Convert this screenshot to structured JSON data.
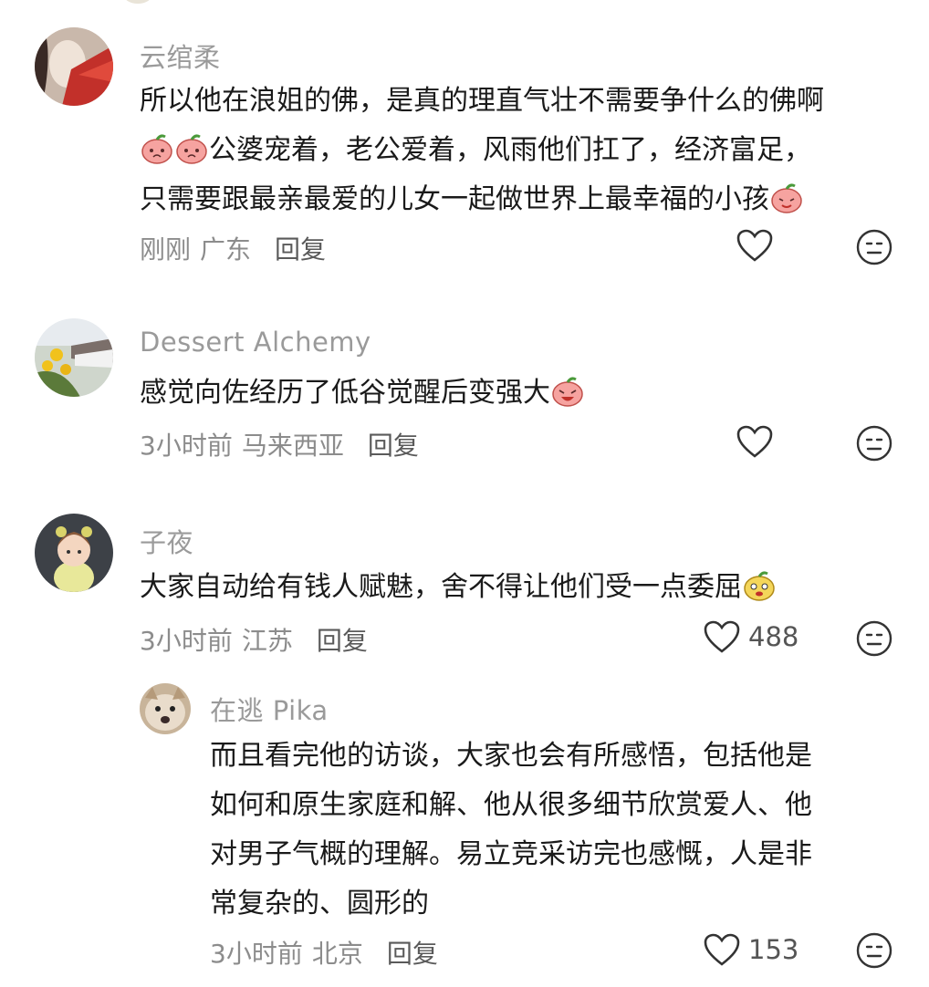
{
  "comments": [
    {
      "username": "云绾柔",
      "lines": [
        "所以他在浪姐的佛，是真的理直气壮不需要争什么的佛啊",
        "公婆宠着，老公爱着，风雨他们扛了，经济富足，",
        "只需要跟最亲最爱的儿女一起做世界上最幸福的小孩"
      ],
      "time": "刚刚",
      "location": "广东",
      "reply_label": "回复",
      "likes": ""
    },
    {
      "username": "Dessert Alchemy",
      "lines": [
        "感觉向佐经历了低谷觉醒后变强大"
      ],
      "time": "3小时前",
      "location": "马来西亚",
      "reply_label": "回复",
      "likes": ""
    },
    {
      "username": "子夜",
      "lines": [
        "大家自动给有钱人赋魅，舍不得让他们受一点委屈"
      ],
      "time": "3小时前",
      "location": "江苏",
      "reply_label": "回复",
      "likes": "488"
    },
    {
      "username": "在逃 Pika",
      "lines": [
        "而且看完他的访谈，大家也会有所感悟，包括他是",
        "如何和原生家庭和解、他从很多细节欣赏爱人、他",
        "对男子气概的理解。易立竞采访完也感慨，人是非",
        "常复杂的、圆形的"
      ],
      "time": "3小时前",
      "location": "北京",
      "reply_label": "回复",
      "likes": "153"
    }
  ],
  "icons": {
    "like": "heart-outline-icon",
    "dislike": "neutral-face-icon",
    "emoji": "peach-emoji-icon"
  },
  "colors": {
    "username": "#9a9a9a",
    "text": "#1a1a1a",
    "meta": "#8c8c8c",
    "emoji_pink": "#f6a3a0"
  }
}
